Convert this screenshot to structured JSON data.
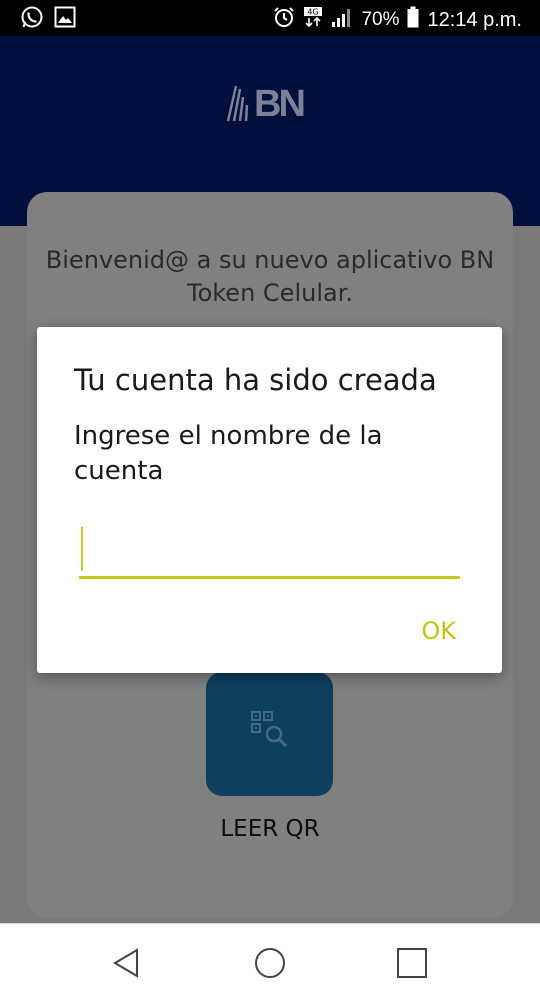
{
  "status_bar": {
    "battery": "70%",
    "time": "12:14 p.m.",
    "network": "4G",
    "icons": [
      "whatsapp-icon",
      "gallery-icon",
      "alarm-icon",
      "network-icon",
      "signal-icon",
      "battery-icon"
    ]
  },
  "header": {
    "logo_text": "BN",
    "background": "#000f3b"
  },
  "page": {
    "welcome_text": "Bienvenid@ a su nuevo aplicativo BN Token Celular.",
    "qr_button_label": "LEER QR"
  },
  "dialog": {
    "title": "Tu cuenta ha sido creada",
    "message": "Ingrese el nombre de la cuenta",
    "input_value": "",
    "ok_label": "OK",
    "accent_color": "#c8c81a"
  },
  "nav_bar": {
    "icons": [
      "back-icon",
      "home-icon",
      "recents-icon"
    ]
  }
}
